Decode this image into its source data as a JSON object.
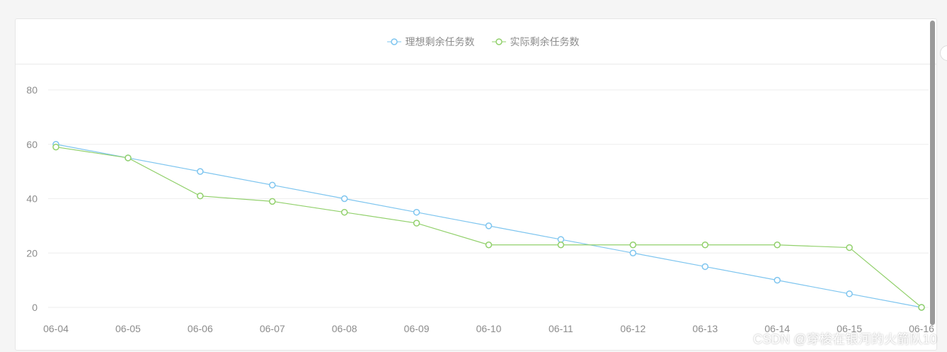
{
  "chart_data": {
    "type": "line",
    "categories": [
      "06-04",
      "06-05",
      "06-06",
      "06-07",
      "06-08",
      "06-09",
      "06-10",
      "06-11",
      "06-12",
      "06-13",
      "06-14",
      "06-15",
      "06-16"
    ],
    "series": [
      {
        "name": "理想剩余任务数",
        "color": "#7ec5ef",
        "values": [
          60,
          55,
          50,
          45,
          40,
          35,
          30,
          25,
          20,
          15,
          10,
          5,
          0
        ]
      },
      {
        "name": "实际剩余任务数",
        "color": "#91d06b",
        "values": [
          59,
          55,
          41,
          39,
          35,
          31,
          23,
          23,
          23,
          23,
          23,
          22,
          0
        ]
      }
    ],
    "yticks": [
      0,
      20,
      40,
      60,
      80
    ],
    "ylim": [
      0,
      80
    ],
    "grid": true,
    "legend_position": "top-center"
  },
  "watermark": "CSDN @穿梭在银河的火箭队10"
}
